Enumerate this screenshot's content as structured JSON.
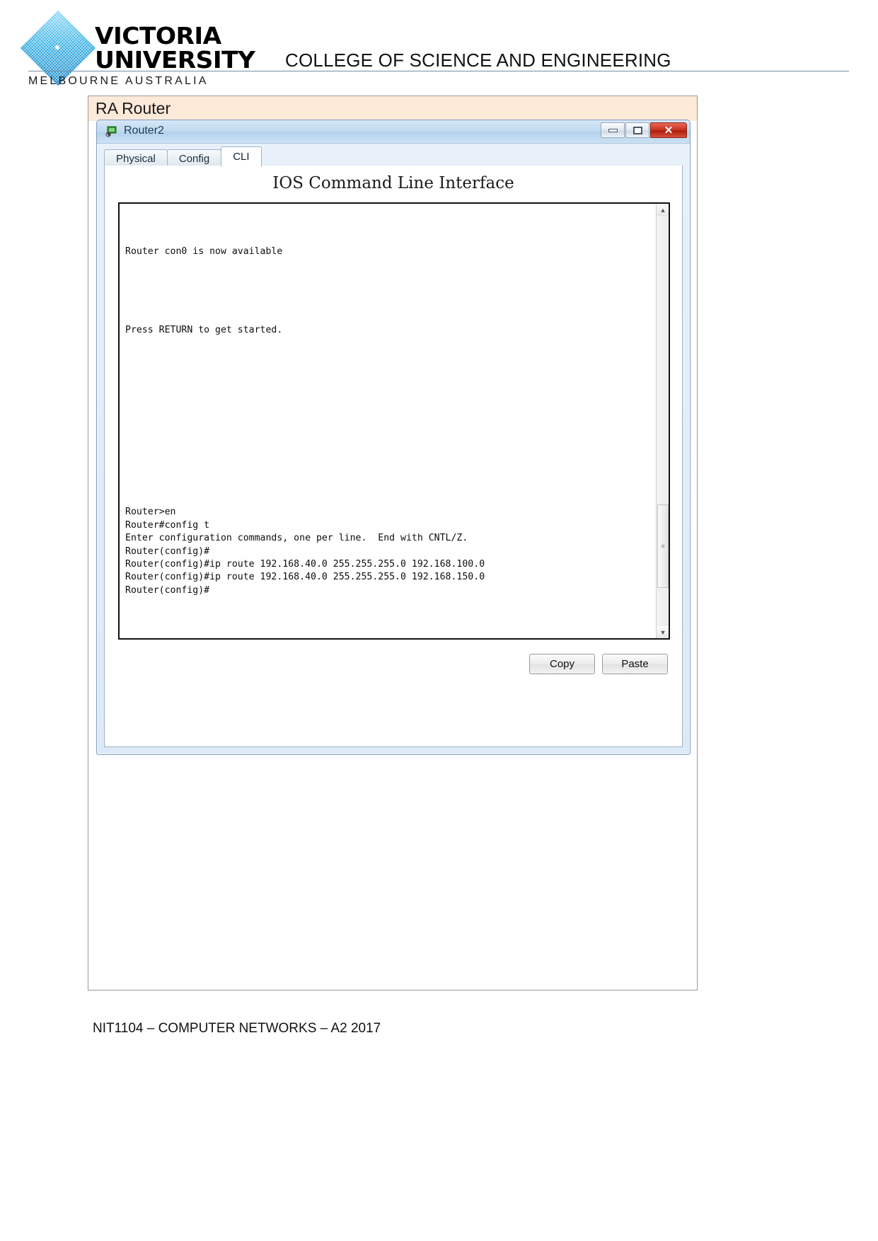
{
  "header": {
    "logo_line1": "VICTORIA",
    "logo_line2": "UNIVERSITY",
    "logo_sub": "MELBOURNE AUSTRALIA",
    "college_title": "COLLEGE OF SCIENCE AND ENGINEERING",
    "logo_icon": "victoria-university-diamond-logo"
  },
  "document": {
    "section_title": "RA Router"
  },
  "window": {
    "title": "Router2",
    "app_icon": "packet-tracer-router-icon",
    "controls": {
      "minimize": "minimize-icon",
      "maximize": "maximize-icon",
      "close": "✕"
    },
    "tabs": [
      {
        "label": "Physical",
        "active": false
      },
      {
        "label": "Config",
        "active": false
      },
      {
        "label": "CLI",
        "active": true
      }
    ],
    "cli": {
      "heading": "IOS Command Line Interface",
      "content": "\n\n\nRouter con0 is now available\n\n\n\n\n\nPress RETURN to get started.\n\n\n\n\n\n\n\n\n\n\n\n\n\nRouter>en\nRouter#config t\nEnter configuration commands, one per line.  End with CNTL/Z.\nRouter(config)#\nRouter(config)#ip route 192.168.40.0 255.255.255.0 192.168.100.0\nRouter(config)#ip route 192.168.40.0 255.255.255.0 192.168.150.0\nRouter(config)#",
      "lines": [
        "Router con0 is now available",
        "Press RETURN to get started.",
        "Router>en",
        "Router#config t",
        "Enter configuration commands, one per line.  End with CNTL/Z.",
        "Router(config)#",
        "Router(config)#ip route 192.168.40.0 255.255.255.0 192.168.100.0",
        "Router(config)#ip route 192.168.40.0 255.255.255.0 192.168.150.0",
        "Router(config)#"
      ],
      "scroll_up_arrow": "▲",
      "scroll_down_arrow": "▼",
      "scroll_thumb_grip": "≡",
      "copy_label": "Copy",
      "paste_label": "Paste"
    }
  },
  "footer": {
    "text": "NIT1104 – COMPUTER NETWORKS – A2 2017"
  },
  "colors": {
    "banner_bg": "#fce9d8",
    "close_button": "#c62b17",
    "logo_blue": "#29abe2",
    "header_rule": "#6f8fa8"
  }
}
